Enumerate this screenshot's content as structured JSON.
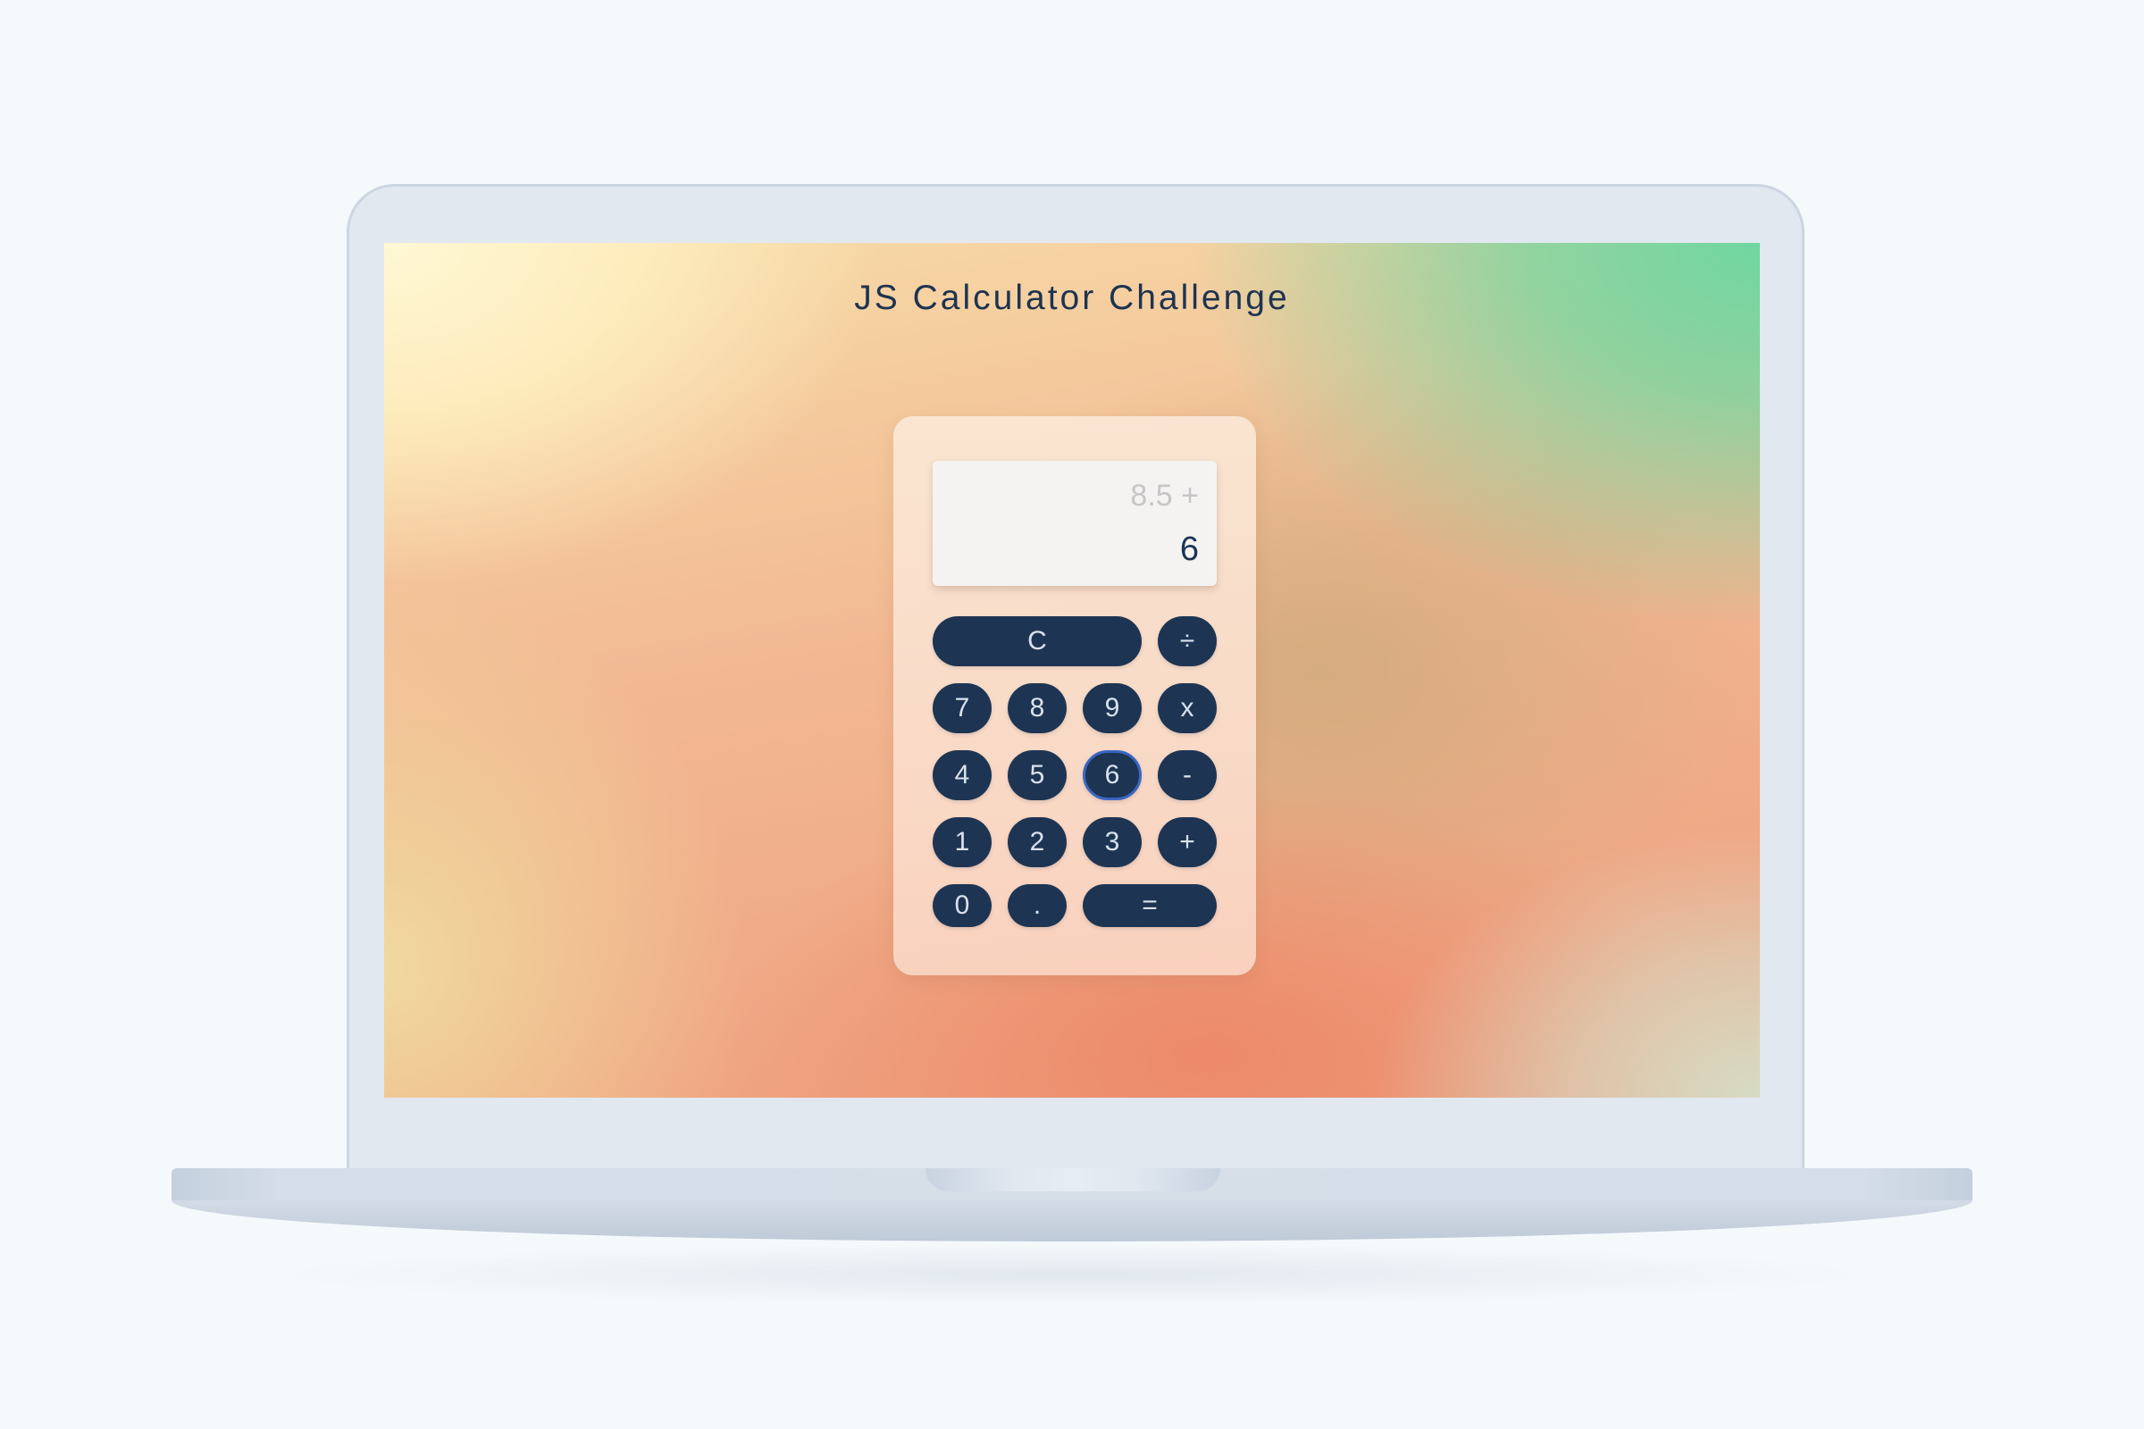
{
  "page": {
    "title": "JS Calculator Challenge"
  },
  "calculator": {
    "display": {
      "previous": "8.5 +",
      "current": "6"
    },
    "buttons": {
      "clear": "C",
      "divide": "÷",
      "seven": "7",
      "eight": "8",
      "nine": "9",
      "multiply": "x",
      "four": "4",
      "five": "5",
      "six": "6",
      "subtract": "-",
      "one": "1",
      "two": "2",
      "three": "3",
      "add": "+",
      "zero": "0",
      "decimal": ".",
      "equals": "="
    },
    "focused_button": "6"
  },
  "colors": {
    "button_bg": "#1d3553",
    "button_text": "#d9e2ec",
    "focus_ring": "#3a66c2",
    "title_text": "#1e3350",
    "display_bg": "#f4f3f2"
  }
}
